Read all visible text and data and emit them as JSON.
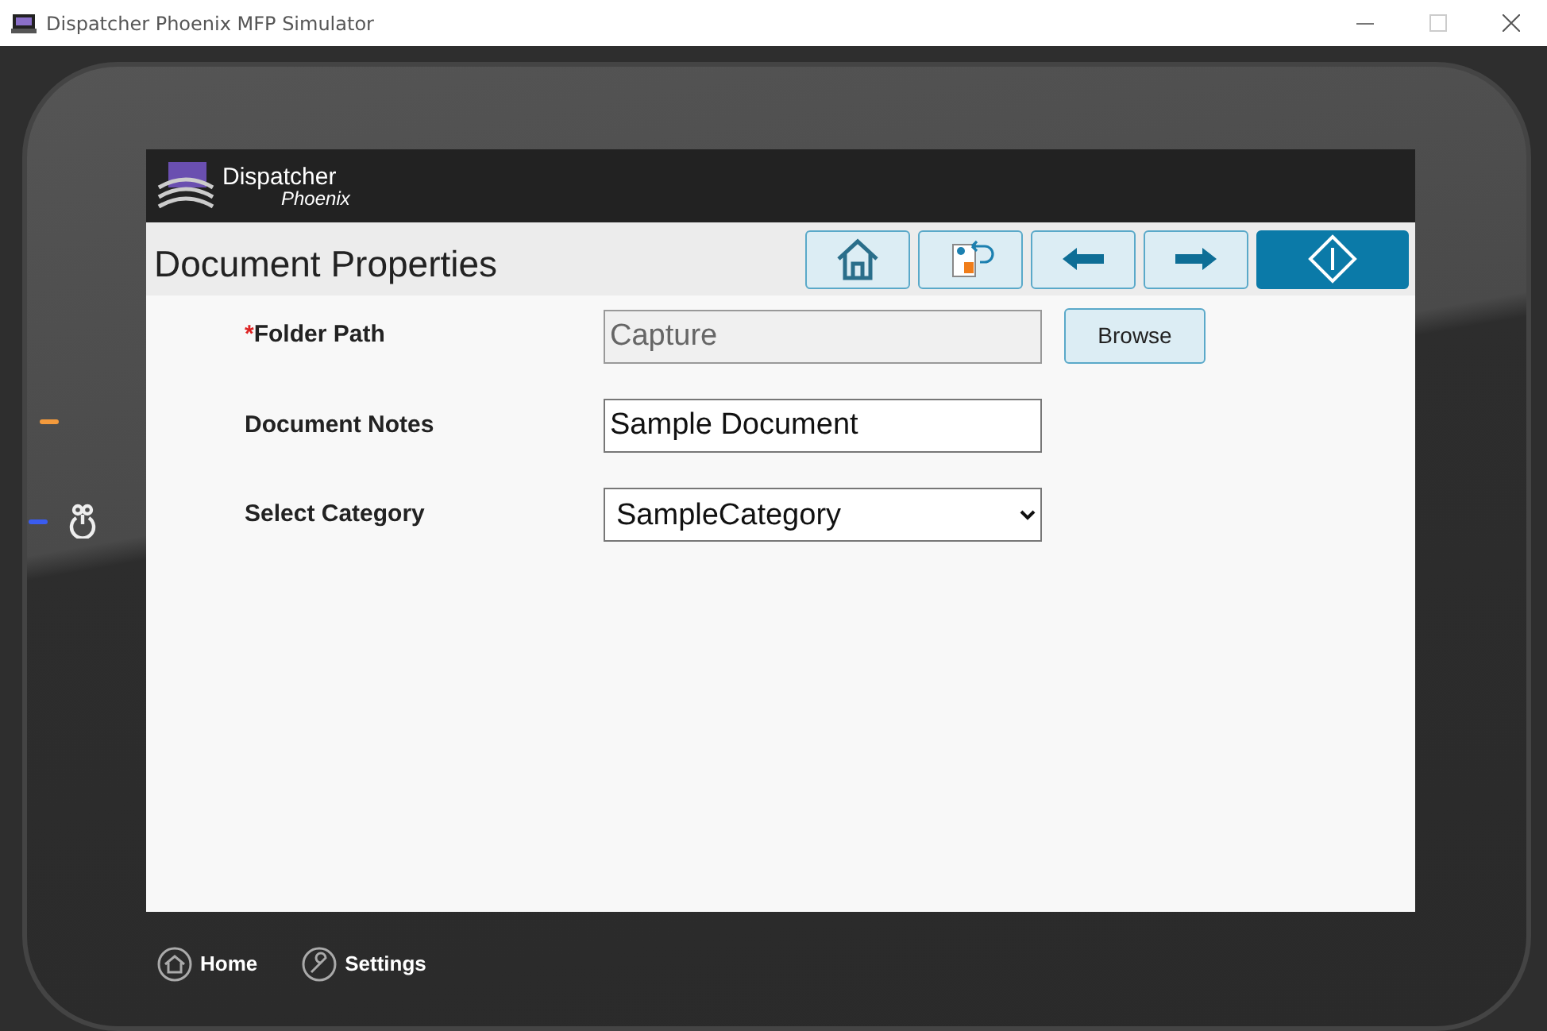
{
  "window": {
    "title": "Dispatcher Phoenix MFP Simulator"
  },
  "indicators": [
    {
      "color": "#f39a3c"
    },
    {
      "color": "#3a5cf0"
    }
  ],
  "logo": {
    "name": "Dispatcher",
    "subname": "Phoenix"
  },
  "page": {
    "title": "Document Properties"
  },
  "toolbar": [
    {
      "kind": "home"
    },
    {
      "kind": "job"
    },
    {
      "kind": "back"
    },
    {
      "kind": "forward"
    },
    {
      "kind": "start"
    }
  ],
  "form": [
    {
      "kind": "text",
      "label": "Folder Path",
      "marker": "*",
      "value": "Capture",
      "disabled": true,
      "button": "Browse"
    },
    {
      "kind": "text",
      "label": "Document Notes",
      "value": "Sample Document",
      "disabled": false
    },
    {
      "kind": "select",
      "label": "Select Category",
      "value": "SampleCategory",
      "disabled": false
    }
  ],
  "footer": [
    {
      "kind": "home",
      "label": "Home"
    },
    {
      "kind": "settings",
      "label": "Settings"
    }
  ]
}
